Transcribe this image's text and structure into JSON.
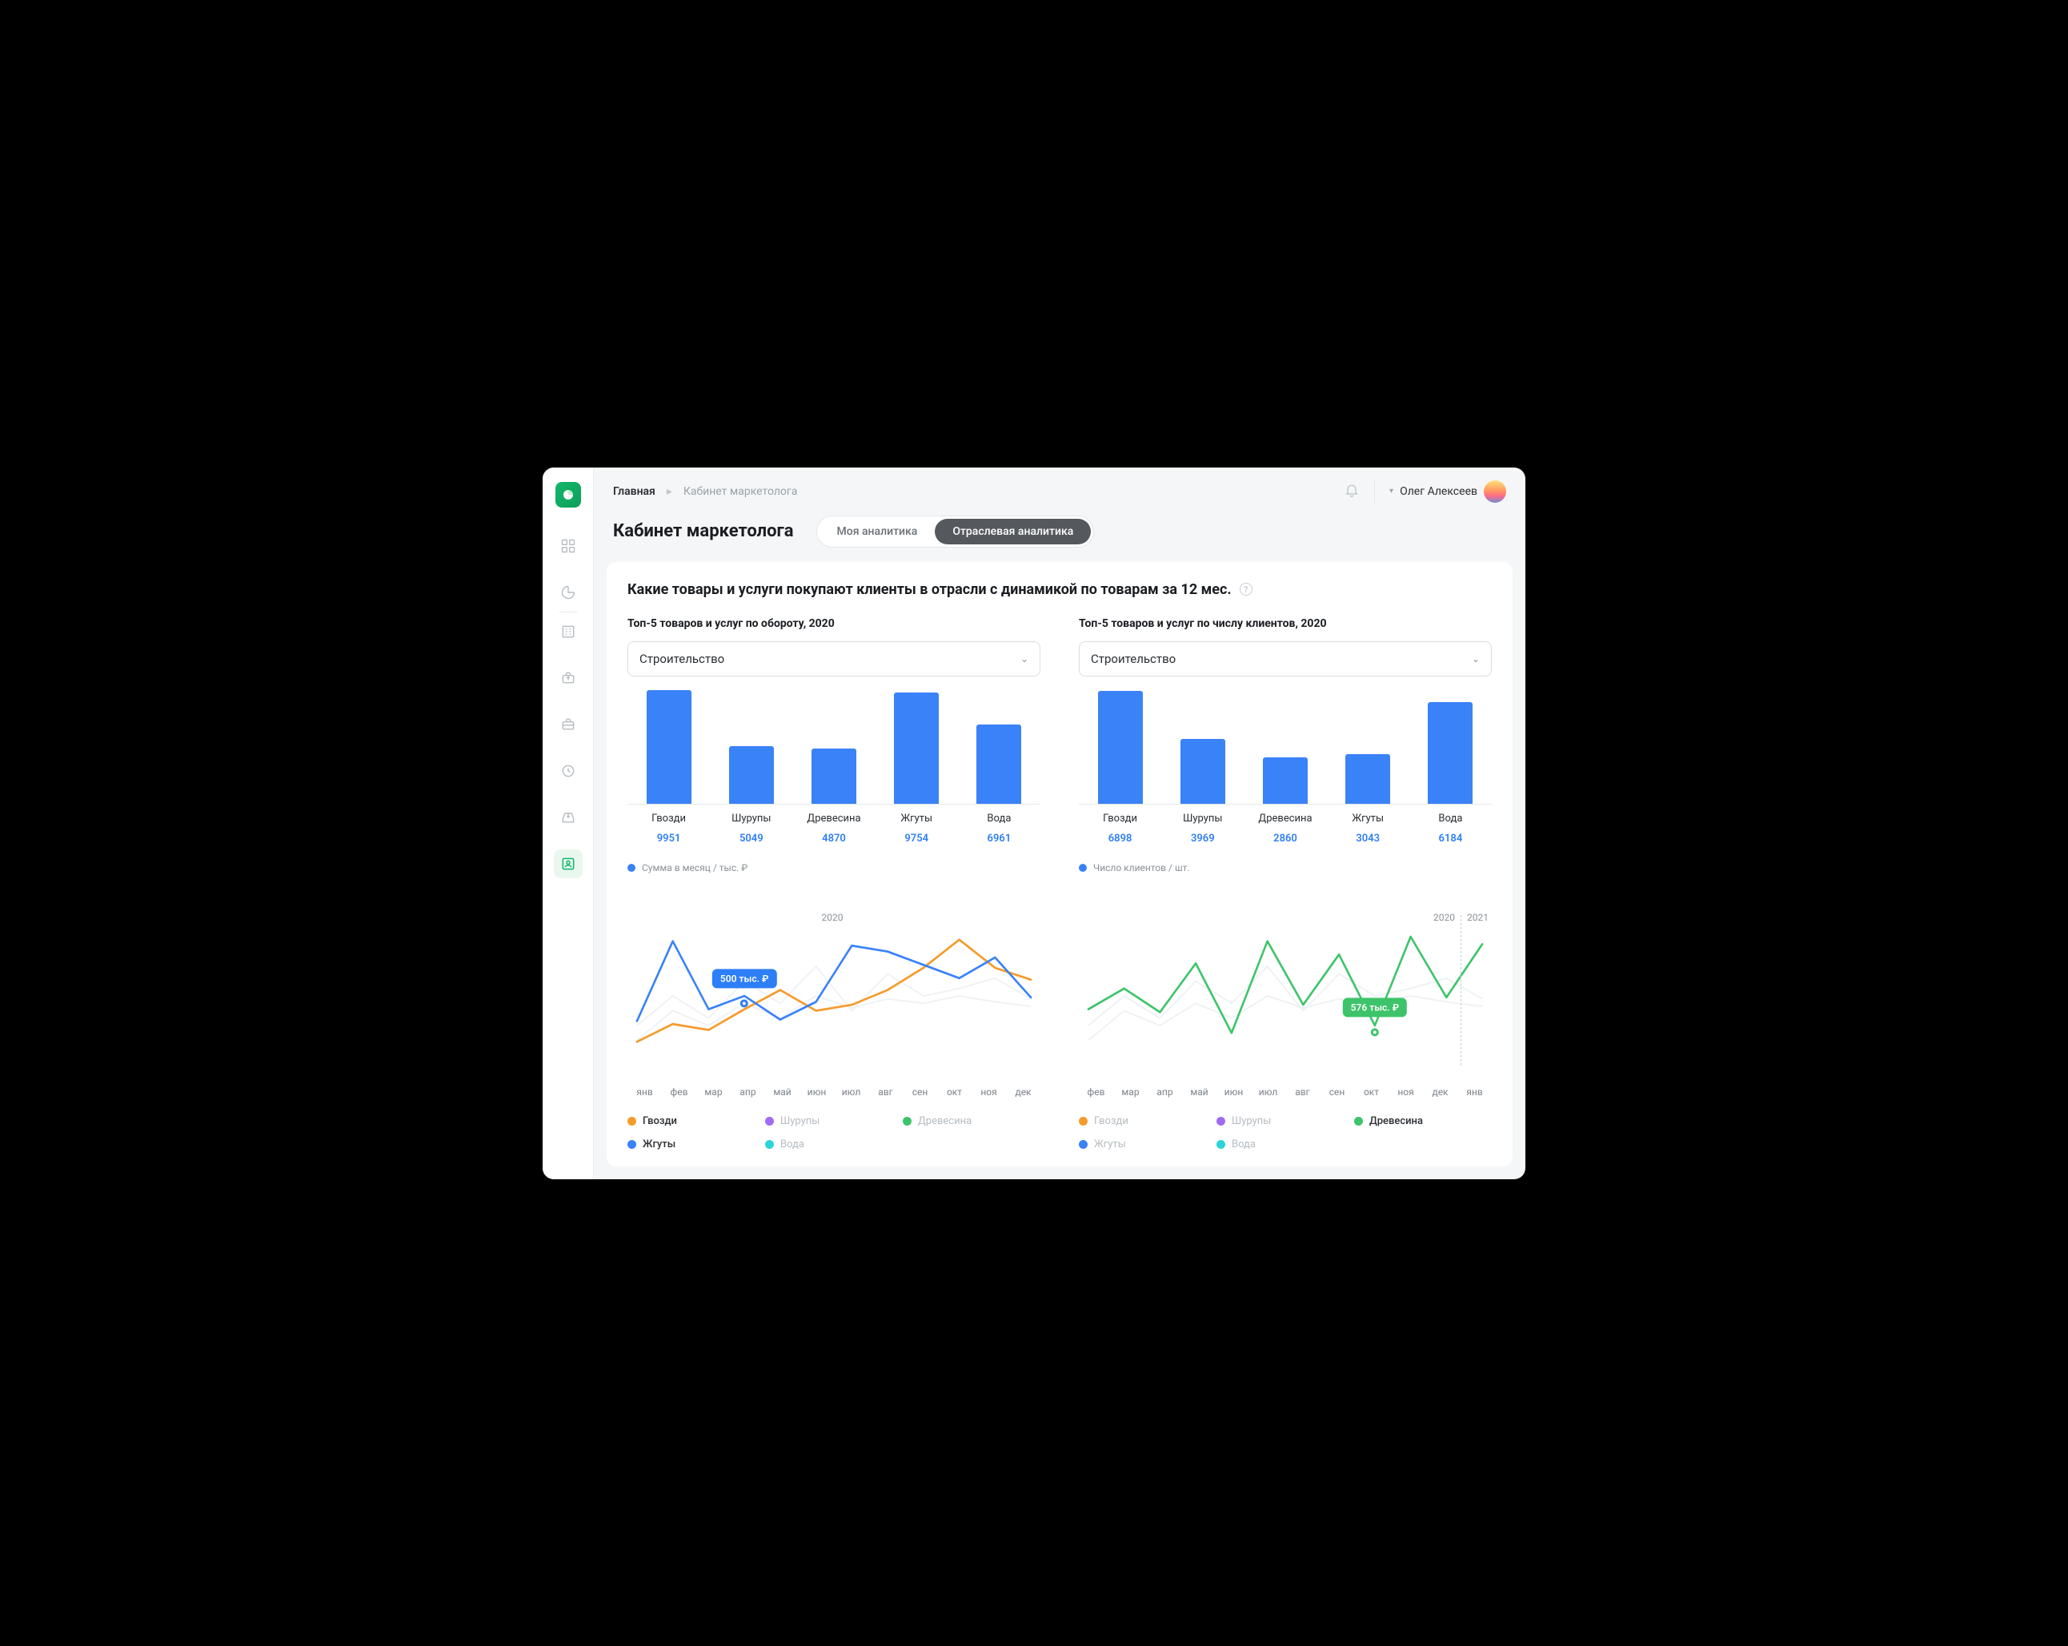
{
  "colors": {
    "blue": "#3a82f7",
    "orange": "#f59b2d",
    "purple": "#a06bf2",
    "green": "#3dc46a",
    "cyan": "#2cd4d9"
  },
  "breadcrumb": {
    "root": "Главная",
    "current": "Кабинет маркетолога"
  },
  "user": {
    "name": "Олег Алексеев"
  },
  "page": {
    "title": "Кабинет маркетолога",
    "tab_my": "Моя аналитика",
    "tab_industry": "Отраслевая аналитика",
    "section_title": "Какие товары и услуги покупают клиенты в отрасли с динамикой по товарам за 12 мес."
  },
  "left": {
    "subhead": "Топ-5 товаров и услуг по обороту, 2020",
    "select": "Строительство",
    "legend": "Сумма в месяц / тыс. ₽",
    "tooltip": "500 тыс. ₽"
  },
  "right": {
    "subhead": "Топ-5 товаров и услуг по числу клиентов, 2020",
    "select": "Строительство",
    "legend": "Число клиентов / шт.",
    "tooltip": "576 тыс. ₽"
  },
  "series_names": [
    "Гвозди",
    "Шурупы",
    "Древесина",
    "Жгуты",
    "Вода"
  ],
  "months_left": [
    "янв",
    "фев",
    "мар",
    "апр",
    "май",
    "июн",
    "июл",
    "авг",
    "сен",
    "окт",
    "ноя",
    "дек"
  ],
  "months_right": [
    "фев",
    "мар",
    "апр",
    "май",
    "июн",
    "июл",
    "авг",
    "сен",
    "окт",
    "ноя",
    "дек",
    "янв"
  ],
  "year_a": "2020",
  "year_b": "2021",
  "chart_data": [
    {
      "id": "bar_left",
      "type": "bar",
      "title": "Топ-5 товаров и услуг по обороту, 2020",
      "ylabel": "Сумма в месяц / тыс. ₽",
      "categories": [
        "Гвозди",
        "Шурупы",
        "Древесина",
        "Жгуты",
        "Вода"
      ],
      "values": [
        9951,
        5049,
        4870,
        9754,
        6961
      ],
      "ylim": [
        0,
        10500
      ]
    },
    {
      "id": "bar_right",
      "type": "bar",
      "title": "Топ-5 товаров и услуг по числу клиентов, 2020",
      "ylabel": "Число клиентов / шт.",
      "categories": [
        "Гвозди",
        "Шурупы",
        "Древесина",
        "Жгуты",
        "Вода"
      ],
      "values": [
        6898,
        3969,
        2860,
        3043,
        6184
      ],
      "ylim": [
        0,
        7300
      ]
    },
    {
      "id": "line_left",
      "type": "line",
      "title": "Динамика, 2020",
      "x": [
        "янв",
        "фев",
        "мар",
        "апр",
        "май",
        "июн",
        "июл",
        "авг",
        "сен",
        "окт",
        "ноя",
        "дек"
      ],
      "ylim": [
        0,
        1000
      ],
      "series": [
        {
          "name": "Гвозди",
          "color": "#f59b2d",
          "values": [
            190,
            310,
            270,
            410,
            540,
            400,
            440,
            540,
            690,
            880,
            690,
            610
          ]
        },
        {
          "name": "Жгуты",
          "color": "#3a82f7",
          "values": [
            330,
            870,
            410,
            500,
            340,
            460,
            840,
            800,
            710,
            620,
            760,
            490
          ]
        }
      ],
      "annotation": {
        "x": "апр",
        "value": 500,
        "series": "Жгуты",
        "label": "500 тыс. ₽"
      }
    },
    {
      "id": "line_right",
      "type": "line",
      "title": "Динамика, 2020–2021",
      "x": [
        "фев",
        "мар",
        "апр",
        "май",
        "июн",
        "июл",
        "авг",
        "сен",
        "окт",
        "ноя",
        "дек",
        "янв"
      ],
      "ylim": [
        0,
        1000
      ],
      "series": [
        {
          "name": "Древесина",
          "color": "#3dc46a",
          "values": [
            410,
            550,
            390,
            720,
            250,
            870,
            440,
            780,
            300,
            900,
            490,
            850,
            430,
            640
          ]
        }
      ],
      "annotation": {
        "x": "окт",
        "value": 576,
        "series": "Древесина",
        "label": "576 тыс. ₽"
      },
      "year_split_after_index": 10
    }
  ]
}
